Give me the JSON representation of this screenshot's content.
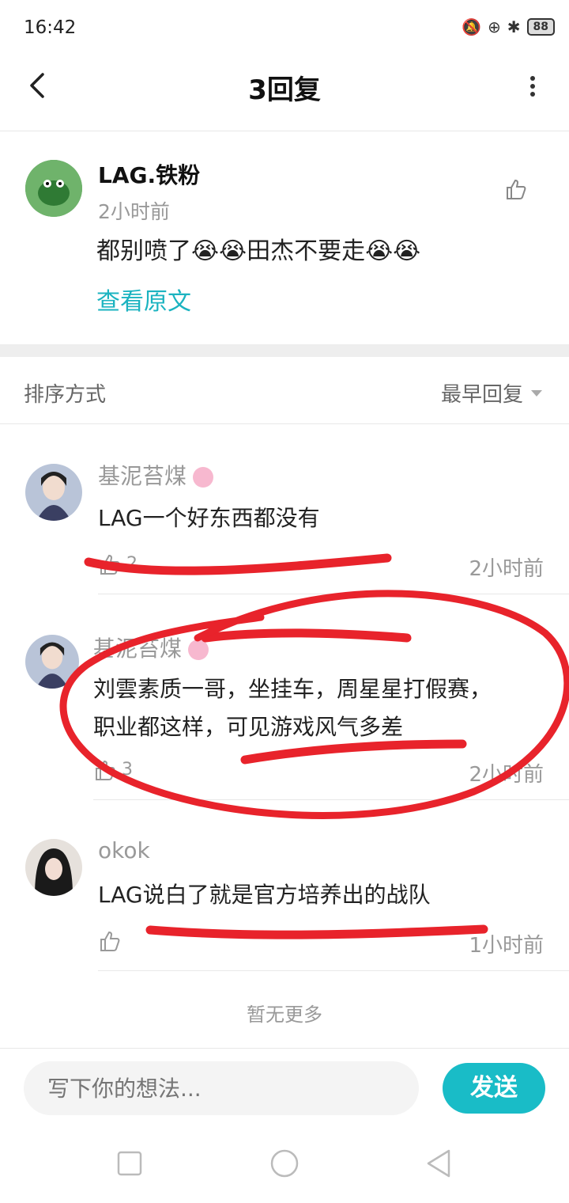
{
  "status": {
    "time": "16:42",
    "battery": "88"
  },
  "header": {
    "title": "3回复"
  },
  "original": {
    "username": "LAG.铁粉",
    "time": "2小时前",
    "text": "都别喷了😭😭田杰不要走😭😭",
    "view_original": "查看原文"
  },
  "sort": {
    "label": "排序方式",
    "value": "最早回复"
  },
  "replies": [
    {
      "username": "基泥苔煤",
      "text": "LAG一个好东西都没有",
      "likes": "2",
      "time": "2小时前"
    },
    {
      "username": "基泥苔煤",
      "text_line1": "刘雲素质一哥，坐挂车，周星星打假赛，",
      "text_line2": "职业都这样，可见游戏风气多差",
      "likes": "3",
      "time": "2小时前"
    },
    {
      "username": "okok",
      "text": "LAG说白了就是官方培养出的战队",
      "likes": "",
      "time": "1小时前"
    }
  ],
  "footer": {
    "no_more": "暂无更多"
  },
  "composer": {
    "placeholder": "写下你的想法...",
    "send_label": "发送"
  },
  "colors": {
    "accent": "#19bcc7",
    "annotation": "#e8232b"
  },
  "icons": [
    "back-arrow-icon",
    "more-vertical-icon",
    "thumbs-up-icon",
    "dropdown-triangle-icon",
    "recent-apps-icon",
    "home-icon",
    "back-nav-icon"
  ]
}
